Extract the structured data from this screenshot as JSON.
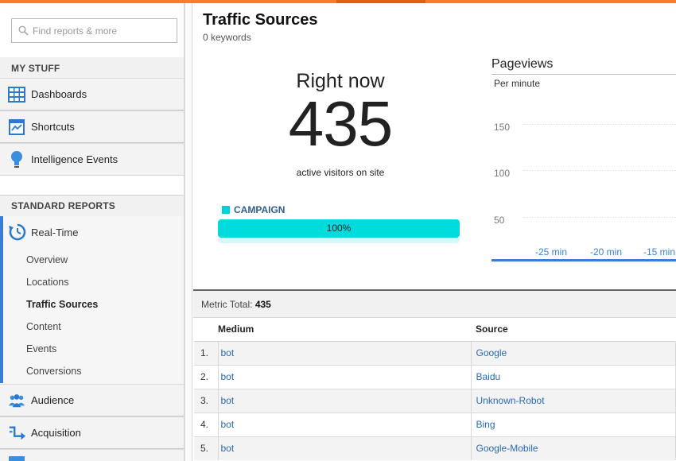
{
  "search": {
    "placeholder": "Find reports & more"
  },
  "sidebar": {
    "my_stuff_header": "MY STUFF",
    "my_stuff": [
      {
        "label": "Dashboards",
        "icon": "dashboards-icon"
      },
      {
        "label": "Shortcuts",
        "icon": "shortcuts-icon"
      },
      {
        "label": "Intelligence Events",
        "icon": "lightbulb-icon"
      }
    ],
    "standard_reports_header": "STANDARD REPORTS",
    "realtime": {
      "label": "Real-Time",
      "icon": "realtime-clock-icon",
      "sub_items": [
        "Overview",
        "Locations",
        "Traffic Sources",
        "Content",
        "Events",
        "Conversions"
      ],
      "active": "Traffic Sources"
    },
    "sections": [
      {
        "label": "Audience",
        "icon": "audience-icon"
      },
      {
        "label": "Acquisition",
        "icon": "acquisition-icon"
      }
    ]
  },
  "header": {
    "title": "Traffic Sources",
    "subtitle": "0 keywords"
  },
  "right_now": {
    "label": "Right now",
    "value": "435",
    "caption": "active visitors on site"
  },
  "campaign": {
    "label": "CAMPAIGN",
    "percent_text": "100%",
    "percent": 100,
    "color": "#00dcdc"
  },
  "pageviews": {
    "title": "Pageviews",
    "subtitle": "Per minute",
    "y_ticks": [
      "150",
      "100",
      "50"
    ],
    "x_ticks": [
      "-25 min",
      "-20 min",
      "-15 min"
    ]
  },
  "metric_total": {
    "label": "Metric Total:",
    "value": "435"
  },
  "table": {
    "columns": [
      "Medium",
      "Source"
    ],
    "rows": [
      {
        "n": "1.",
        "medium": "bot",
        "source": "Google"
      },
      {
        "n": "2.",
        "medium": "bot",
        "source": "Baidu"
      },
      {
        "n": "3.",
        "medium": "bot",
        "source": "Unknown-Robot"
      },
      {
        "n": "4.",
        "medium": "bot",
        "source": "Bing"
      },
      {
        "n": "5.",
        "medium": "bot",
        "source": "Google-Mobile"
      }
    ]
  },
  "colors": {
    "accent": "#3a7fd5",
    "topbar": "#ff7a2a",
    "campaign": "#00dcdc"
  }
}
